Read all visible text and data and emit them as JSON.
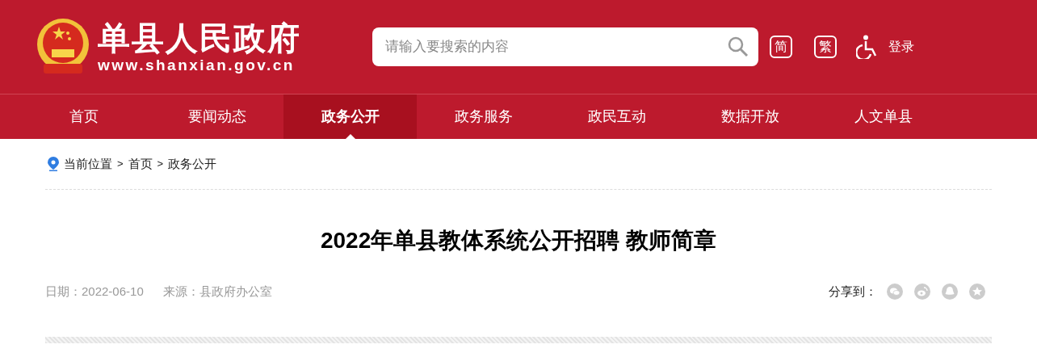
{
  "site": {
    "title": "单县人民政府",
    "url": "www.shanxian.gov.cn"
  },
  "search": {
    "placeholder": "请输入要搜索的内容"
  },
  "tools": {
    "simplified": "简",
    "traditional": "繁",
    "login": "登录"
  },
  "nav": [
    {
      "label": "首页",
      "selected": false
    },
    {
      "label": "要闻动态",
      "selected": false
    },
    {
      "label": "政务公开",
      "selected": true
    },
    {
      "label": "政务服务",
      "selected": false
    },
    {
      "label": "政民互动",
      "selected": false
    },
    {
      "label": "数据开放",
      "selected": false
    },
    {
      "label": "人文单县",
      "selected": false
    }
  ],
  "breadcrumb": {
    "prefix": "当前位置",
    "separator": ">",
    "items": [
      "首页",
      "政务公开"
    ]
  },
  "article": {
    "title": "2022年单县教体系统公开招聘 教师简章",
    "date": "日期：2022-06-10",
    "source": "来源：县政府办公室"
  },
  "share": {
    "label": "分享到：",
    "targets": [
      {
        "kind": "wechat"
      },
      {
        "kind": "weibo"
      },
      {
        "kind": "qq"
      },
      {
        "kind": "qzone"
      }
    ]
  }
}
